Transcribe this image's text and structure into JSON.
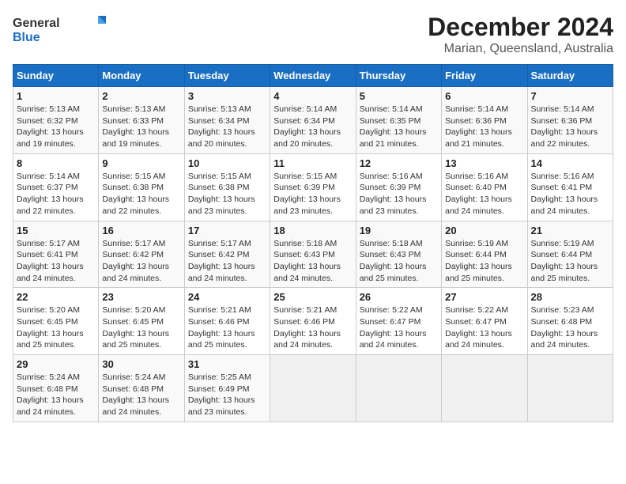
{
  "logo": {
    "general": "General",
    "blue": "Blue"
  },
  "title": {
    "month": "December 2024",
    "location": "Marian, Queensland, Australia"
  },
  "days_of_week": [
    "Sunday",
    "Monday",
    "Tuesday",
    "Wednesday",
    "Thursday",
    "Friday",
    "Saturday"
  ],
  "weeks": [
    [
      {
        "day": "1",
        "sunrise": "5:13 AM",
        "sunset": "6:32 PM",
        "daylight": "13 hours and 19 minutes."
      },
      {
        "day": "2",
        "sunrise": "5:13 AM",
        "sunset": "6:33 PM",
        "daylight": "13 hours and 19 minutes."
      },
      {
        "day": "3",
        "sunrise": "5:13 AM",
        "sunset": "6:34 PM",
        "daylight": "13 hours and 20 minutes."
      },
      {
        "day": "4",
        "sunrise": "5:14 AM",
        "sunset": "6:34 PM",
        "daylight": "13 hours and 20 minutes."
      },
      {
        "day": "5",
        "sunrise": "5:14 AM",
        "sunset": "6:35 PM",
        "daylight": "13 hours and 21 minutes."
      },
      {
        "day": "6",
        "sunrise": "5:14 AM",
        "sunset": "6:36 PM",
        "daylight": "13 hours and 21 minutes."
      },
      {
        "day": "7",
        "sunrise": "5:14 AM",
        "sunset": "6:36 PM",
        "daylight": "13 hours and 22 minutes."
      }
    ],
    [
      {
        "day": "8",
        "sunrise": "5:14 AM",
        "sunset": "6:37 PM",
        "daylight": "13 hours and 22 minutes."
      },
      {
        "day": "9",
        "sunrise": "5:15 AM",
        "sunset": "6:38 PM",
        "daylight": "13 hours and 22 minutes."
      },
      {
        "day": "10",
        "sunrise": "5:15 AM",
        "sunset": "6:38 PM",
        "daylight": "13 hours and 23 minutes."
      },
      {
        "day": "11",
        "sunrise": "5:15 AM",
        "sunset": "6:39 PM",
        "daylight": "13 hours and 23 minutes."
      },
      {
        "day": "12",
        "sunrise": "5:16 AM",
        "sunset": "6:39 PM",
        "daylight": "13 hours and 23 minutes."
      },
      {
        "day": "13",
        "sunrise": "5:16 AM",
        "sunset": "6:40 PM",
        "daylight": "13 hours and 24 minutes."
      },
      {
        "day": "14",
        "sunrise": "5:16 AM",
        "sunset": "6:41 PM",
        "daylight": "13 hours and 24 minutes."
      }
    ],
    [
      {
        "day": "15",
        "sunrise": "5:17 AM",
        "sunset": "6:41 PM",
        "daylight": "13 hours and 24 minutes."
      },
      {
        "day": "16",
        "sunrise": "5:17 AM",
        "sunset": "6:42 PM",
        "daylight": "13 hours and 24 minutes."
      },
      {
        "day": "17",
        "sunrise": "5:17 AM",
        "sunset": "6:42 PM",
        "daylight": "13 hours and 24 minutes."
      },
      {
        "day": "18",
        "sunrise": "5:18 AM",
        "sunset": "6:43 PM",
        "daylight": "13 hours and 24 minutes."
      },
      {
        "day": "19",
        "sunrise": "5:18 AM",
        "sunset": "6:43 PM",
        "daylight": "13 hours and 25 minutes."
      },
      {
        "day": "20",
        "sunrise": "5:19 AM",
        "sunset": "6:44 PM",
        "daylight": "13 hours and 25 minutes."
      },
      {
        "day": "21",
        "sunrise": "5:19 AM",
        "sunset": "6:44 PM",
        "daylight": "13 hours and 25 minutes."
      }
    ],
    [
      {
        "day": "22",
        "sunrise": "5:20 AM",
        "sunset": "6:45 PM",
        "daylight": "13 hours and 25 minutes."
      },
      {
        "day": "23",
        "sunrise": "5:20 AM",
        "sunset": "6:45 PM",
        "daylight": "13 hours and 25 minutes."
      },
      {
        "day": "24",
        "sunrise": "5:21 AM",
        "sunset": "6:46 PM",
        "daylight": "13 hours and 25 minutes."
      },
      {
        "day": "25",
        "sunrise": "5:21 AM",
        "sunset": "6:46 PM",
        "daylight": "13 hours and 24 minutes."
      },
      {
        "day": "26",
        "sunrise": "5:22 AM",
        "sunset": "6:47 PM",
        "daylight": "13 hours and 24 minutes."
      },
      {
        "day": "27",
        "sunrise": "5:22 AM",
        "sunset": "6:47 PM",
        "daylight": "13 hours and 24 minutes."
      },
      {
        "day": "28",
        "sunrise": "5:23 AM",
        "sunset": "6:48 PM",
        "daylight": "13 hours and 24 minutes."
      }
    ],
    [
      {
        "day": "29",
        "sunrise": "5:24 AM",
        "sunset": "6:48 PM",
        "daylight": "13 hours and 24 minutes."
      },
      {
        "day": "30",
        "sunrise": "5:24 AM",
        "sunset": "6:48 PM",
        "daylight": "13 hours and 24 minutes."
      },
      {
        "day": "31",
        "sunrise": "5:25 AM",
        "sunset": "6:49 PM",
        "daylight": "13 hours and 23 minutes."
      },
      null,
      null,
      null,
      null
    ]
  ],
  "labels": {
    "sunrise": "Sunrise:",
    "sunset": "Sunset:",
    "daylight": "Daylight:"
  }
}
